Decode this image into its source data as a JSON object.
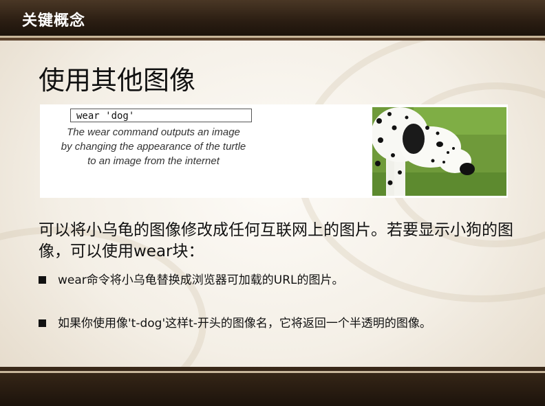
{
  "header": {
    "title": "关键概念"
  },
  "slide": {
    "title": "使用其他图像"
  },
  "figure": {
    "code": "wear 'dog'",
    "caption_lines": [
      "The wear command outputs an image",
      "by changing the appearance of the turtle",
      "to an image from the internet"
    ]
  },
  "body": {
    "paragraph": "可以将小乌龟的图像修改成任何互联网上的图片。若要显示小狗的图像，可以使用wear块：",
    "bullets": [
      "wear命令将小乌龟替换成浏览器可加载的URL的图片。",
      "如果你使用像't-dog'这样t-开头的图像名，它将返回一个半透明的图像。"
    ]
  }
}
